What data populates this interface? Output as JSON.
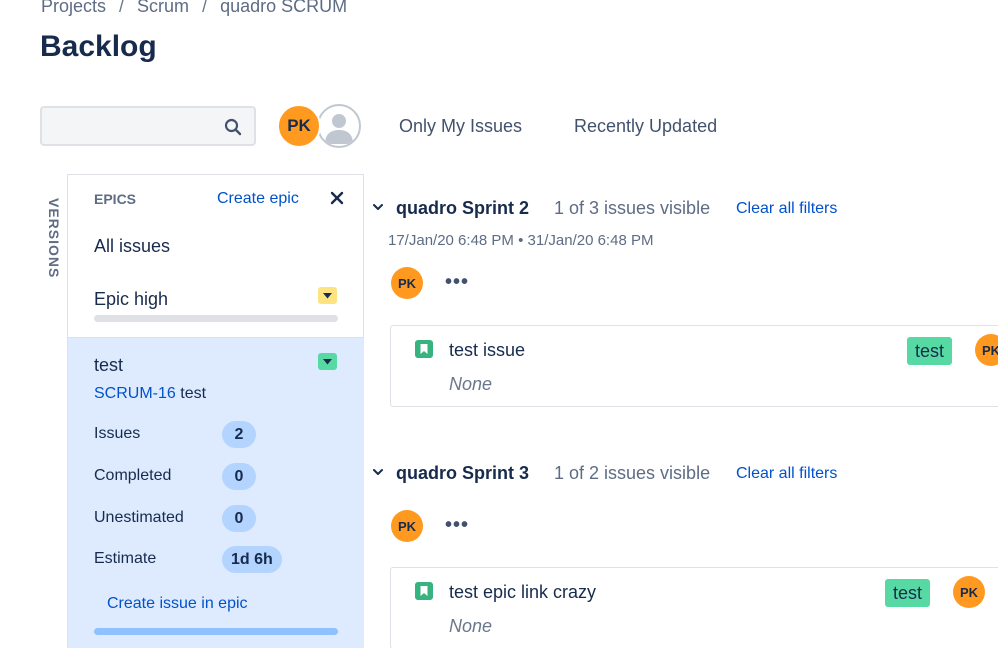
{
  "breadcrumb": {
    "items": [
      "Projects",
      "Scrum",
      "quadro SCRUM"
    ],
    "separator": "/"
  },
  "page": {
    "title": "Backlog"
  },
  "search": {
    "value": "",
    "placeholder": "",
    "icon": "search-icon"
  },
  "avatars": {
    "assignee_initials": "PK",
    "avatar_color": "#ff991f"
  },
  "quick_filters": [
    {
      "label": "Only My Issues"
    },
    {
      "label": "Recently Updated"
    }
  ],
  "versions_tab": {
    "label": "VERSIONS"
  },
  "epics": {
    "header": "EPICS",
    "create_label": "Create epic",
    "all_issues_label": "All issues",
    "items": [
      {
        "name": "Epic high",
        "color": "#ffe380"
      },
      {
        "name": "test",
        "color": "#57d9a3",
        "issue_key": "SCRUM-16",
        "issue_summary": "test",
        "stats": [
          {
            "label": "Issues",
            "value": "2"
          },
          {
            "label": "Completed",
            "value": "0"
          },
          {
            "label": "Unestimated",
            "value": "0"
          },
          {
            "label": "Estimate",
            "value": "1d 6h"
          }
        ],
        "create_issue_label": "Create issue in epic"
      }
    ]
  },
  "sprints": [
    {
      "name": "quadro Sprint 2",
      "visible_text": "1 of 3 issues visible",
      "clear_filters": "Clear all filters",
      "start": "17/Jan/20 6:48 PM",
      "date_separator": "•",
      "end": "31/Jan/20 6:48 PM",
      "issues": [
        {
          "summary": "test issue",
          "epic": "None",
          "label": "test",
          "assignee": "PK",
          "type_icon": "story-icon"
        }
      ]
    },
    {
      "name": "quadro Sprint 3",
      "visible_text": "1 of 2 issues visible",
      "clear_filters": "Clear all filters",
      "issues": [
        {
          "summary": "test epic link crazy",
          "epic": "None",
          "label": "test",
          "assignee": "PK",
          "type_icon": "story-icon"
        }
      ]
    }
  ],
  "more_actions": "•••",
  "colors": {
    "link": "#0052cc",
    "epic_selected_bg": "#deebff",
    "label_bg": "#57d9a3",
    "story_icon": "#36b37e"
  }
}
